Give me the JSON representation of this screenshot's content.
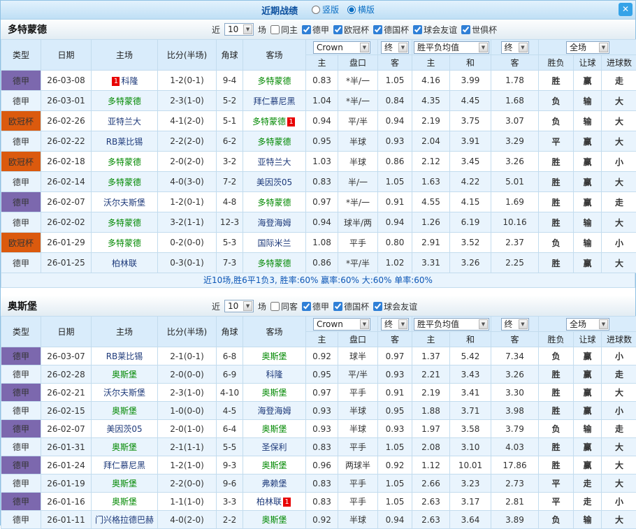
{
  "titlebar": {
    "title": "近期战绩",
    "layout_options": [
      {
        "label": "竖版",
        "selected": false
      },
      {
        "label": "横版",
        "selected": true
      }
    ],
    "close_glyph": "✕"
  },
  "colors": {
    "bundesliga_badge": "#7C68AE",
    "ucl_badge": "#DB5A0E",
    "focal_team_green": "#008800",
    "opponent_team_navy": "#1E3A7A",
    "score_red": "#E03333",
    "result_red": "#FF0000",
    "result_blue": "#0000DD",
    "result_green": "#009933",
    "header_bg": "#D9ECFB",
    "row_alt_bg": "#E9F4FD",
    "title_blue": "#0B4F9E",
    "close_button_blue": "#35A3E8"
  },
  "sections": [
    {
      "team": "多特蒙德",
      "compact": false,
      "filter": {
        "near_label": "近",
        "near_value": "10",
        "games_label": "场",
        "checkboxes": [
          {
            "label": "同主",
            "checked": false
          },
          {
            "label": "德甲",
            "checked": true
          },
          {
            "label": "欧冠杯",
            "checked": true
          },
          {
            "label": "德国杯",
            "checked": true
          },
          {
            "label": "球会友谊",
            "checked": true
          },
          {
            "label": "世俱杯",
            "checked": true
          }
        ]
      },
      "header": {
        "cols": [
          "类型",
          "日期",
          "主场",
          "比分(半场)",
          "角球",
          "客场"
        ],
        "bookmaker_select": "Crown",
        "final_select": "终",
        "avg_select": "胜平负均值",
        "final_select2": "终",
        "scope_select": "全场",
        "odds_cols": [
          "主",
          "盘口",
          "客"
        ],
        "avg_cols": [
          "主",
          "和",
          "客"
        ],
        "result_cols": [
          "胜负",
          "让球",
          "进球数"
        ]
      },
      "rows": [
        {
          "league": "德甲",
          "league_class": "bund",
          "date": "26-03-08",
          "home": {
            "name": "科隆",
            "focal": false,
            "card": "1"
          },
          "score": "1-2(0-1)",
          "corners": "9-4",
          "away": {
            "name": "多特蒙德",
            "focal": true
          },
          "odds": [
            "0.83",
            "*半/一",
            "1.05"
          ],
          "avg": [
            "4.16",
            "3.99",
            "1.78"
          ],
          "results": [
            {
              "t": "胜",
              "c": "r"
            },
            {
              "t": "赢",
              "c": "r"
            },
            {
              "t": "走",
              "c": "b"
            }
          ]
        },
        {
          "league": "德甲",
          "league_class": "bund",
          "date": "26-03-01",
          "home": {
            "name": "多特蒙德",
            "focal": true
          },
          "score": "2-3(1-0)",
          "corners": "5-2",
          "away": {
            "name": "拜仁慕尼黑",
            "focal": false
          },
          "odds": [
            "1.04",
            "*半/一",
            "0.84"
          ],
          "avg": [
            "4.35",
            "4.45",
            "1.68"
          ],
          "results": [
            {
              "t": "负",
              "c": "b"
            },
            {
              "t": "输",
              "c": "g"
            },
            {
              "t": "大",
              "c": "r"
            }
          ]
        },
        {
          "league": "欧冠杯",
          "league_class": "ucl",
          "date": "26-02-26",
          "home": {
            "name": "亚特兰大",
            "focal": false
          },
          "score": "4-1(2-0)",
          "corners": "5-1",
          "away": {
            "name": "多特蒙德",
            "focal": true,
            "card": "1"
          },
          "odds": [
            "0.94",
            "平/半",
            "0.94"
          ],
          "avg": [
            "2.19",
            "3.75",
            "3.07"
          ],
          "results": [
            {
              "t": "负",
              "c": "b"
            },
            {
              "t": "输",
              "c": "g"
            },
            {
              "t": "大",
              "c": "r"
            }
          ]
        },
        {
          "league": "德甲",
          "league_class": "bund",
          "date": "26-02-22",
          "home": {
            "name": "RB莱比锡",
            "focal": false
          },
          "score": "2-2(2-0)",
          "corners": "6-2",
          "away": {
            "name": "多特蒙德",
            "focal": true
          },
          "odds": [
            "0.95",
            "半球",
            "0.93"
          ],
          "avg": [
            "2.04",
            "3.91",
            "3.29"
          ],
          "results": [
            {
              "t": "平",
              "c": "b"
            },
            {
              "t": "赢",
              "c": "r"
            },
            {
              "t": "大",
              "c": "r"
            }
          ]
        },
        {
          "league": "欧冠杯",
          "league_class": "ucl",
          "date": "26-02-18",
          "home": {
            "name": "多特蒙德",
            "focal": true
          },
          "score": "2-0(2-0)",
          "corners": "3-2",
          "away": {
            "name": "亚特兰大",
            "focal": false
          },
          "odds": [
            "1.03",
            "半球",
            "0.86"
          ],
          "avg": [
            "2.12",
            "3.45",
            "3.26"
          ],
          "results": [
            {
              "t": "胜",
              "c": "r"
            },
            {
              "t": "赢",
              "c": "r"
            },
            {
              "t": "小",
              "c": "b"
            }
          ]
        },
        {
          "league": "德甲",
          "league_class": "bund",
          "date": "26-02-14",
          "home": {
            "name": "多特蒙德",
            "focal": true
          },
          "score": "4-0(3-0)",
          "corners": "7-2",
          "away": {
            "name": "美因茨05",
            "focal": false
          },
          "odds": [
            "0.83",
            "半/一",
            "1.05"
          ],
          "avg": [
            "1.63",
            "4.22",
            "5.01"
          ],
          "results": [
            {
              "t": "胜",
              "c": "r"
            },
            {
              "t": "赢",
              "c": "r"
            },
            {
              "t": "大",
              "c": "r"
            }
          ]
        },
        {
          "league": "德甲",
          "league_class": "bund",
          "date": "26-02-07",
          "home": {
            "name": "沃尔夫斯堡",
            "focal": false
          },
          "score": "1-2(0-1)",
          "corners": "4-8",
          "away": {
            "name": "多特蒙德",
            "focal": true
          },
          "odds": [
            "0.97",
            "*半/一",
            "0.91"
          ],
          "avg": [
            "4.55",
            "4.15",
            "1.69"
          ],
          "results": [
            {
              "t": "胜",
              "c": "r"
            },
            {
              "t": "赢",
              "c": "r"
            },
            {
              "t": "走",
              "c": "b"
            }
          ]
        },
        {
          "league": "德甲",
          "league_class": "bund",
          "date": "26-02-02",
          "home": {
            "name": "多特蒙德",
            "focal": true
          },
          "score": "3-2(1-1)",
          "corners": "12-3",
          "away": {
            "name": "海登海姆",
            "focal": false
          },
          "odds": [
            "0.94",
            "球半/两",
            "0.94"
          ],
          "avg": [
            "1.26",
            "6.19",
            "10.16"
          ],
          "results": [
            {
              "t": "胜",
              "c": "r"
            },
            {
              "t": "输",
              "c": "g"
            },
            {
              "t": "大",
              "c": "r"
            }
          ]
        },
        {
          "league": "欧冠杯",
          "league_class": "ucl",
          "date": "26-01-29",
          "home": {
            "name": "多特蒙德",
            "focal": true
          },
          "score": "0-2(0-0)",
          "corners": "5-3",
          "away": {
            "name": "国际米兰",
            "focal": false
          },
          "odds": [
            "1.08",
            "平手",
            "0.80"
          ],
          "avg": [
            "2.91",
            "3.52",
            "2.37"
          ],
          "results": [
            {
              "t": "负",
              "c": "b"
            },
            {
              "t": "输",
              "c": "g"
            },
            {
              "t": "小",
              "c": "b"
            }
          ]
        },
        {
          "league": "德甲",
          "league_class": "bund",
          "date": "26-01-25",
          "home": {
            "name": "柏林联",
            "focal": false
          },
          "score": "0-3(0-1)",
          "corners": "7-3",
          "away": {
            "name": "多特蒙德",
            "focal": true
          },
          "odds": [
            "0.86",
            "*平/半",
            "1.02"
          ],
          "avg": [
            "3.31",
            "3.26",
            "2.25"
          ],
          "results": [
            {
              "t": "胜",
              "c": "r"
            },
            {
              "t": "赢",
              "c": "r"
            },
            {
              "t": "大",
              "c": "r"
            }
          ]
        }
      ],
      "footer": "近10场,胜6平1负3, 胜率:60% 赢率:60% 大:60% 单率:60%"
    },
    {
      "team": "奥斯堡",
      "compact": true,
      "filter": {
        "near_label": "近",
        "near_value": "10",
        "games_label": "场",
        "checkboxes": [
          {
            "label": "同客",
            "checked": false
          },
          {
            "label": "德甲",
            "checked": true
          },
          {
            "label": "德国杯",
            "checked": true
          },
          {
            "label": "球会友谊",
            "checked": true
          }
        ]
      },
      "header": {
        "cols": [
          "类型",
          "日期",
          "主场",
          "比分(半场)",
          "角球",
          "客场"
        ],
        "bookmaker_select": "Crown",
        "final_select": "终",
        "avg_select": "胜平负均值",
        "final_select2": "终",
        "scope_select": "全场",
        "odds_cols": [
          "主",
          "盘口",
          "客"
        ],
        "avg_cols": [
          "主",
          "和",
          "客"
        ],
        "result_cols": [
          "胜负",
          "让球",
          "进球数"
        ]
      },
      "rows": [
        {
          "league": "德甲",
          "league_class": "bund",
          "date": "26-03-07",
          "home": {
            "name": "RB莱比锡",
            "focal": false
          },
          "score": "2-1(0-1)",
          "corners": "6-8",
          "away": {
            "name": "奥斯堡",
            "focal": true
          },
          "odds": [
            "0.92",
            "球半",
            "0.97"
          ],
          "avg": [
            "1.37",
            "5.42",
            "7.34"
          ],
          "results": [
            {
              "t": "负",
              "c": "b"
            },
            {
              "t": "赢",
              "c": "r"
            },
            {
              "t": "小",
              "c": "b"
            }
          ]
        },
        {
          "league": "德甲",
          "league_class": "bund",
          "date": "26-02-28",
          "home": {
            "name": "奥斯堡",
            "focal": true
          },
          "score": "2-0(0-0)",
          "corners": "6-9",
          "away": {
            "name": "科隆",
            "focal": false
          },
          "odds": [
            "0.95",
            "平/半",
            "0.93"
          ],
          "avg": [
            "2.21",
            "3.43",
            "3.26"
          ],
          "results": [
            {
              "t": "胜",
              "c": "r"
            },
            {
              "t": "赢",
              "c": "r"
            },
            {
              "t": "走",
              "c": "b"
            }
          ]
        },
        {
          "league": "德甲",
          "league_class": "bund",
          "date": "26-02-21",
          "home": {
            "name": "沃尔夫斯堡",
            "focal": false
          },
          "score": "2-3(1-0)",
          "corners": "4-10",
          "away": {
            "name": "奥斯堡",
            "focal": true
          },
          "odds": [
            "0.97",
            "平手",
            "0.91"
          ],
          "avg": [
            "2.19",
            "3.41",
            "3.30"
          ],
          "results": [
            {
              "t": "胜",
              "c": "r"
            },
            {
              "t": "赢",
              "c": "r"
            },
            {
              "t": "大",
              "c": "r"
            }
          ]
        },
        {
          "league": "德甲",
          "league_class": "bund",
          "date": "26-02-15",
          "home": {
            "name": "奥斯堡",
            "focal": true
          },
          "score": "1-0(0-0)",
          "corners": "4-5",
          "away": {
            "name": "海登海姆",
            "focal": false
          },
          "odds": [
            "0.93",
            "半球",
            "0.95"
          ],
          "avg": [
            "1.88",
            "3.71",
            "3.98"
          ],
          "results": [
            {
              "t": "胜",
              "c": "r"
            },
            {
              "t": "赢",
              "c": "r"
            },
            {
              "t": "小",
              "c": "b"
            }
          ]
        },
        {
          "league": "德甲",
          "league_class": "bund",
          "date": "26-02-07",
          "home": {
            "name": "美因茨05",
            "focal": false
          },
          "score": "2-0(1-0)",
          "corners": "6-4",
          "away": {
            "name": "奥斯堡",
            "focal": true
          },
          "odds": [
            "0.93",
            "半球",
            "0.93"
          ],
          "avg": [
            "1.97",
            "3.58",
            "3.79"
          ],
          "results": [
            {
              "t": "负",
              "c": "b"
            },
            {
              "t": "输",
              "c": "g"
            },
            {
              "t": "走",
              "c": "b"
            }
          ]
        },
        {
          "league": "德甲",
          "league_class": "bund",
          "date": "26-01-31",
          "home": {
            "name": "奥斯堡",
            "focal": true
          },
          "score": "2-1(1-1)",
          "corners": "5-5",
          "away": {
            "name": "圣保利",
            "focal": false
          },
          "odds": [
            "0.83",
            "平手",
            "1.05"
          ],
          "avg": [
            "2.08",
            "3.10",
            "4.03"
          ],
          "results": [
            {
              "t": "胜",
              "c": "r"
            },
            {
              "t": "赢",
              "c": "r"
            },
            {
              "t": "大",
              "c": "r"
            }
          ]
        },
        {
          "league": "德甲",
          "league_class": "bund",
          "date": "26-01-24",
          "home": {
            "name": "拜仁慕尼黑",
            "focal": false
          },
          "score": "1-2(1-0)",
          "corners": "9-3",
          "away": {
            "name": "奥斯堡",
            "focal": true
          },
          "odds": [
            "0.96",
            "两球半",
            "0.92"
          ],
          "avg": [
            "1.12",
            "10.01",
            "17.86"
          ],
          "results": [
            {
              "t": "胜",
              "c": "r"
            },
            {
              "t": "赢",
              "c": "r"
            },
            {
              "t": "大",
              "c": "r"
            }
          ]
        },
        {
          "league": "德甲",
          "league_class": "bund",
          "date": "26-01-19",
          "home": {
            "name": "奥斯堡",
            "focal": true
          },
          "score": "2-2(0-0)",
          "corners": "9-6",
          "away": {
            "name": "弗赖堡",
            "focal": false
          },
          "odds": [
            "0.83",
            "平手",
            "1.05"
          ],
          "avg": [
            "2.66",
            "3.23",
            "2.73"
          ],
          "results": [
            {
              "t": "平",
              "c": "b"
            },
            {
              "t": "走",
              "c": "b"
            },
            {
              "t": "大",
              "c": "r"
            }
          ]
        },
        {
          "league": "德甲",
          "league_class": "bund",
          "date": "26-01-16",
          "home": {
            "name": "奥斯堡",
            "focal": true
          },
          "score": "1-1(1-0)",
          "corners": "3-3",
          "away": {
            "name": "柏林联",
            "focal": false,
            "card": "1"
          },
          "odds": [
            "0.83",
            "平手",
            "1.05"
          ],
          "avg": [
            "2.63",
            "3.17",
            "2.81"
          ],
          "results": [
            {
              "t": "平",
              "c": "b"
            },
            {
              "t": "走",
              "c": "b"
            },
            {
              "t": "小",
              "c": "b"
            }
          ]
        },
        {
          "league": "德甲",
          "league_class": "bund",
          "date": "26-01-11",
          "home": {
            "name": "门兴格拉德巴赫",
            "focal": false
          },
          "score": "4-0(2-0)",
          "corners": "2-2",
          "away": {
            "name": "奥斯堡",
            "focal": true
          },
          "odds": [
            "0.92",
            "半球",
            "0.94"
          ],
          "avg": [
            "2.63",
            "3.64",
            "3.89"
          ],
          "results": [
            {
              "t": "负",
              "c": "b"
            },
            {
              "t": "输",
              "c": "g"
            },
            {
              "t": "大",
              "c": "r"
            }
          ]
        }
      ],
      "footer": ""
    }
  ]
}
